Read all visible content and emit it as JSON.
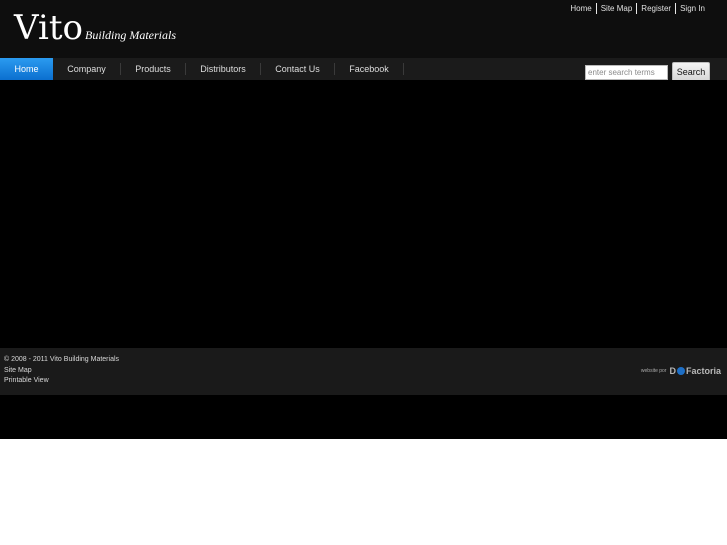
{
  "logo": {
    "name": "Vito",
    "tagline": "Building Materials"
  },
  "utility_links": [
    "Home",
    "Site Map",
    "Register",
    "Sign In"
  ],
  "nav": {
    "items": [
      {
        "label": "Home",
        "active": true
      },
      {
        "label": "Company",
        "active": false
      },
      {
        "label": "Products",
        "active": false
      },
      {
        "label": "Distributors",
        "active": false
      },
      {
        "label": "Contact Us",
        "active": false
      },
      {
        "label": "Facebook",
        "active": false
      }
    ]
  },
  "search": {
    "placeholder": "enter search terms",
    "value": "",
    "button_label": "Search"
  },
  "footer": {
    "copyright": "© 2008 - 2011 Vito Building Materials",
    "links": [
      "Site Map",
      "Printable View"
    ],
    "credit_prefix": "website por",
    "credit_name": "Factoria"
  },
  "colors": {
    "accent": "#1a84e0",
    "background": "#000000",
    "header": "#0e0e0e",
    "navbar": "#1b1b1b",
    "footer": "#1a1a1a"
  }
}
